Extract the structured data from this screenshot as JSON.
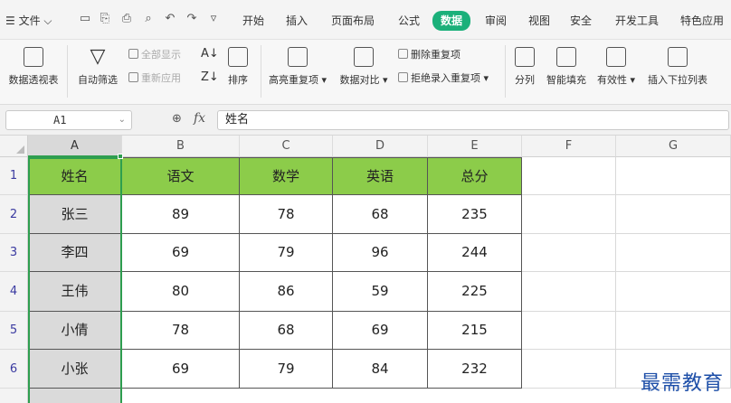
{
  "menu": {
    "file": "文件",
    "tabs": [
      "开始",
      "插入",
      "页面布局",
      "公式",
      "数据",
      "审阅",
      "视图",
      "安全",
      "开发工具",
      "特色应用"
    ],
    "active_tab": "数据"
  },
  "ribbon": {
    "pivot": "数据透视表",
    "autofilter": "自动筛选",
    "show_all": "全部显示",
    "reapply": "重新应用",
    "sort": "排序",
    "highlight_dup": "高亮重复项",
    "compare": "数据对比",
    "remove_dup": "删除重复项",
    "reject_dup": "拒绝录入重复项",
    "split": "分列",
    "smart_fill": "智能填充",
    "validity": "有效性",
    "insert_dropdown": "插入下拉列表"
  },
  "formula_bar": {
    "cell_ref": "A1",
    "fx": "fx",
    "value": "姓名"
  },
  "columns": [
    "A",
    "B",
    "C",
    "D",
    "E",
    "F",
    "G"
  ],
  "rows": [
    "1",
    "2",
    "3",
    "4",
    "5",
    "6"
  ],
  "table": {
    "headers": [
      "姓名",
      "语文",
      "数学",
      "英语",
      "总分"
    ],
    "records": [
      [
        "张三",
        "89",
        "78",
        "68",
        "235"
      ],
      [
        "李四",
        "69",
        "79",
        "96",
        "244"
      ],
      [
        "王伟",
        "80",
        "86",
        "59",
        "225"
      ],
      [
        "小倩",
        "78",
        "68",
        "69",
        "215"
      ],
      [
        "小张",
        "69",
        "79",
        "84",
        "232"
      ]
    ]
  },
  "colors": {
    "accent": "#1bb07a",
    "header_fill": "#8ccc4a",
    "selection": "#2e9e4f",
    "name_col_fill": "#dadada"
  },
  "watermark": "最需教育"
}
